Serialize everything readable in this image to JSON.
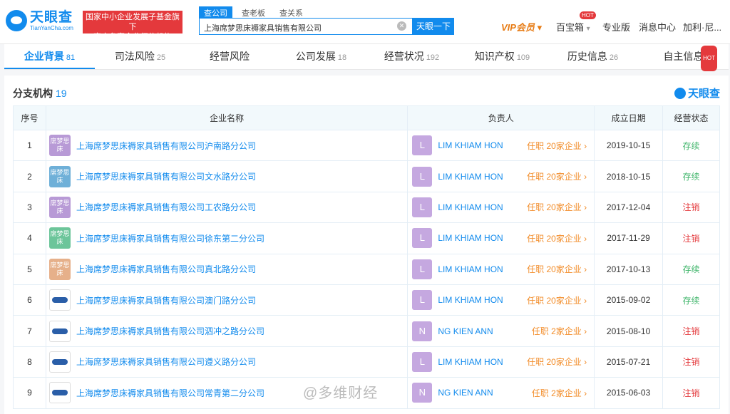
{
  "header": {
    "logo_cn": "天眼查",
    "logo_en": "TianYanCha.com",
    "badge_line1": "国家中小企业发展子基金旗下",
    "badge_line2": "官方备案企业征信机构",
    "search_tabs": [
      "查公司",
      "查老板",
      "查关系"
    ],
    "search_value": "上海席梦思床褥家具销售有限公司",
    "search_button": "天眼一下",
    "vip": "VIP会员",
    "toolbox": "百宝箱",
    "hot": "HOT",
    "pro": "专业版",
    "messages": "消息中心",
    "user": "加利·尼..."
  },
  "tabs": [
    {
      "label": "企业背景",
      "count": "81"
    },
    {
      "label": "司法风险",
      "count": "25"
    },
    {
      "label": "经营风险",
      "count": ""
    },
    {
      "label": "公司发展",
      "count": "18"
    },
    {
      "label": "经营状况",
      "count": "192"
    },
    {
      "label": "知识产权",
      "count": "109"
    },
    {
      "label": "历史信息",
      "count": "26"
    },
    {
      "label": "自主信息",
      "count": ""
    }
  ],
  "panel": {
    "title": "分支机构",
    "count": "19",
    "brand": "天眼查"
  },
  "table": {
    "headers": [
      "序号",
      "企业名称",
      "负责人",
      "成立日期",
      "经营状态"
    ],
    "rows": [
      {
        "no": "1",
        "logo": "席梦思床",
        "name": "上海席梦思床褥家具销售有限公司沪南路分公司",
        "initial": "L",
        "person": "LIM KHIAM HON",
        "tag": "任职 20家企业",
        "date": "2019-10-15",
        "status": "存续"
      },
      {
        "no": "2",
        "logo": "席梦思床",
        "name": "上海席梦思床褥家具销售有限公司文水路分公司",
        "initial": "L",
        "person": "LIM KHIAM HON",
        "tag": "任职 20家企业",
        "date": "2018-10-15",
        "status": "存续"
      },
      {
        "no": "3",
        "logo": "席梦思床",
        "name": "上海席梦思床褥家具销售有限公司工农路分公司",
        "initial": "L",
        "person": "LIM KHIAM HON",
        "tag": "任职 20家企业",
        "date": "2017-12-04",
        "status": "注销"
      },
      {
        "no": "4",
        "logo": "席梦思床",
        "name": "上海席梦思床褥家具销售有限公司徐东第二分公司",
        "initial": "L",
        "person": "LIM KHIAM HON",
        "tag": "任职 20家企业",
        "date": "2017-11-29",
        "status": "注销"
      },
      {
        "no": "5",
        "logo": "席梦思床",
        "name": "上海席梦思床褥家具销售有限公司真北路分公司",
        "initial": "L",
        "person": "LIM KHIAM HON",
        "tag": "任职 20家企业",
        "date": "2017-10-13",
        "status": "存续"
      },
      {
        "no": "6",
        "logo": "",
        "name": "上海席梦思床褥家具销售有限公司澳门路分公司",
        "initial": "L",
        "person": "LIM KHIAM HON",
        "tag": "任职 20家企业",
        "date": "2015-09-02",
        "status": "存续"
      },
      {
        "no": "7",
        "logo": "",
        "name": "上海席梦思床褥家具销售有限公司泗冲之路分公司",
        "initial": "N",
        "person": "NG KIEN ANN",
        "tag": "任职 2家企业",
        "date": "2015-08-10",
        "status": "注销"
      },
      {
        "no": "8",
        "logo": "",
        "name": "上海席梦思床褥家具销售有限公司遵义路分公司",
        "initial": "L",
        "person": "LIM KHIAM HON",
        "tag": "任职 20家企业",
        "date": "2015-07-21",
        "status": "注销"
      },
      {
        "no": "9",
        "logo": "",
        "name": "上海席梦思床褥家具销售有限公司常青第二分公司",
        "initial": "N",
        "person": "NG KIEN ANN",
        "tag": "任职 2家企业",
        "date": "2015-06-03",
        "status": "注销"
      }
    ]
  },
  "colors": {
    "accent": "#128bed",
    "status_ok": "#3fb56a",
    "status_bad": "#e4393c",
    "tag": "#f28c28",
    "logo_colors": [
      "#b89ad6",
      "#6fb0d8",
      "#b89ad6",
      "#6cc59a",
      "#e6b08a"
    ]
  },
  "watermark": "@多维财经"
}
